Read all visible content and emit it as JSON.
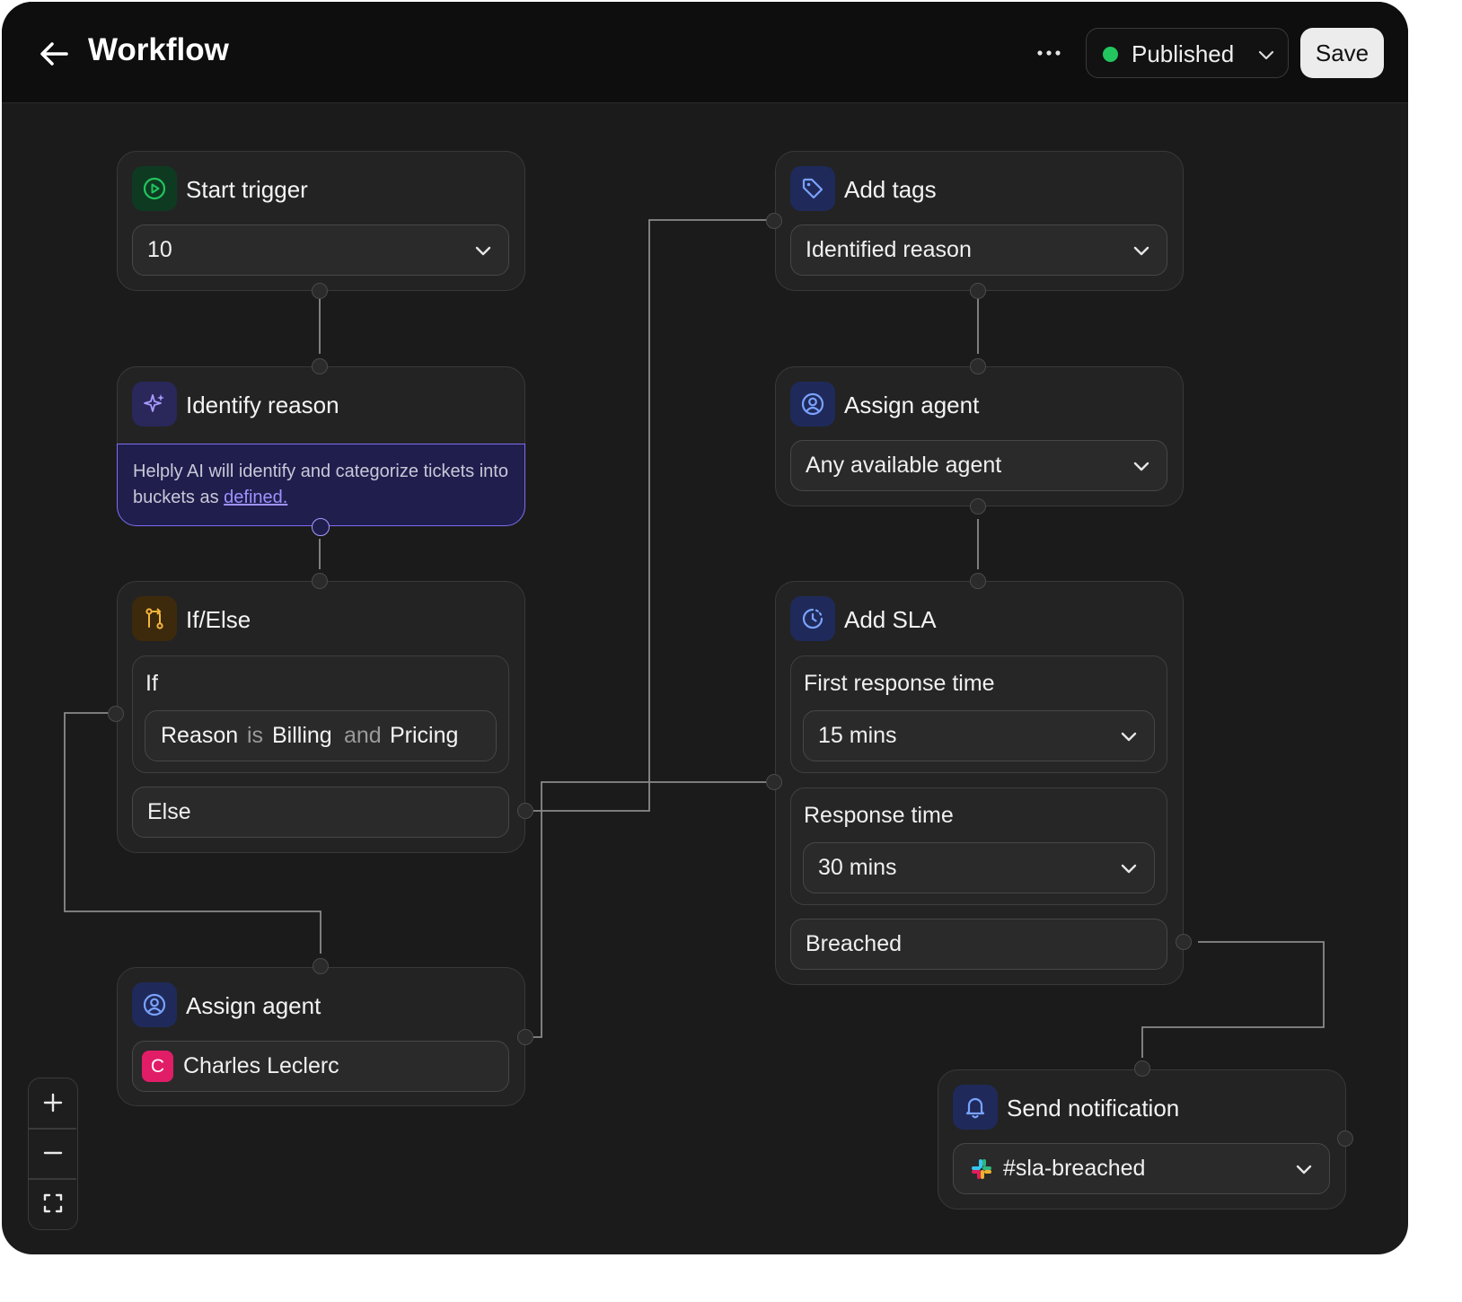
{
  "header": {
    "title": "Workflow",
    "status_label": "Published",
    "status_color": "#22c55e",
    "save_label": "Save"
  },
  "nodes": {
    "start_trigger": {
      "title": "Start trigger",
      "value": "10",
      "icon": "play-circle-icon"
    },
    "identify_reason": {
      "title": "Identify reason",
      "icon": "sparkles-icon",
      "description": "Helply AI will identify and categorize tickets into buckets as ",
      "link": "defined."
    },
    "if_else": {
      "title": "If/Else",
      "icon": "git-branch-icon",
      "if_label": "If",
      "condition": {
        "field": "Reason",
        "op": "is",
        "value1": "Billing",
        "conj": "and",
        "value2": "Pricing"
      },
      "else_label": "Else"
    },
    "assign_agent_left": {
      "title": "Assign agent",
      "icon": "user-circle-icon",
      "avatar_letter": "C",
      "agent": "Charles Leclerc"
    },
    "add_tags": {
      "title": "Add tags",
      "icon": "tag-icon",
      "value": "Identified reason"
    },
    "assign_agent_right": {
      "title": "Assign agent",
      "icon": "user-circle-icon",
      "value": "Any available agent"
    },
    "add_sla": {
      "title": "Add SLA",
      "icon": "clock-icon",
      "first_response_label": "First response time",
      "first_response_value": "15 mins",
      "response_label": "Response time",
      "response_value": "30 mins",
      "breached_label": "Breached"
    },
    "send_notification": {
      "title": "Send notification",
      "icon": "bell-icon",
      "channel": "#sla-breached"
    }
  },
  "zoom_controls": {
    "zoom_in": "plus-icon",
    "zoom_out": "minus-icon",
    "fit": "fullscreen-icon"
  }
}
